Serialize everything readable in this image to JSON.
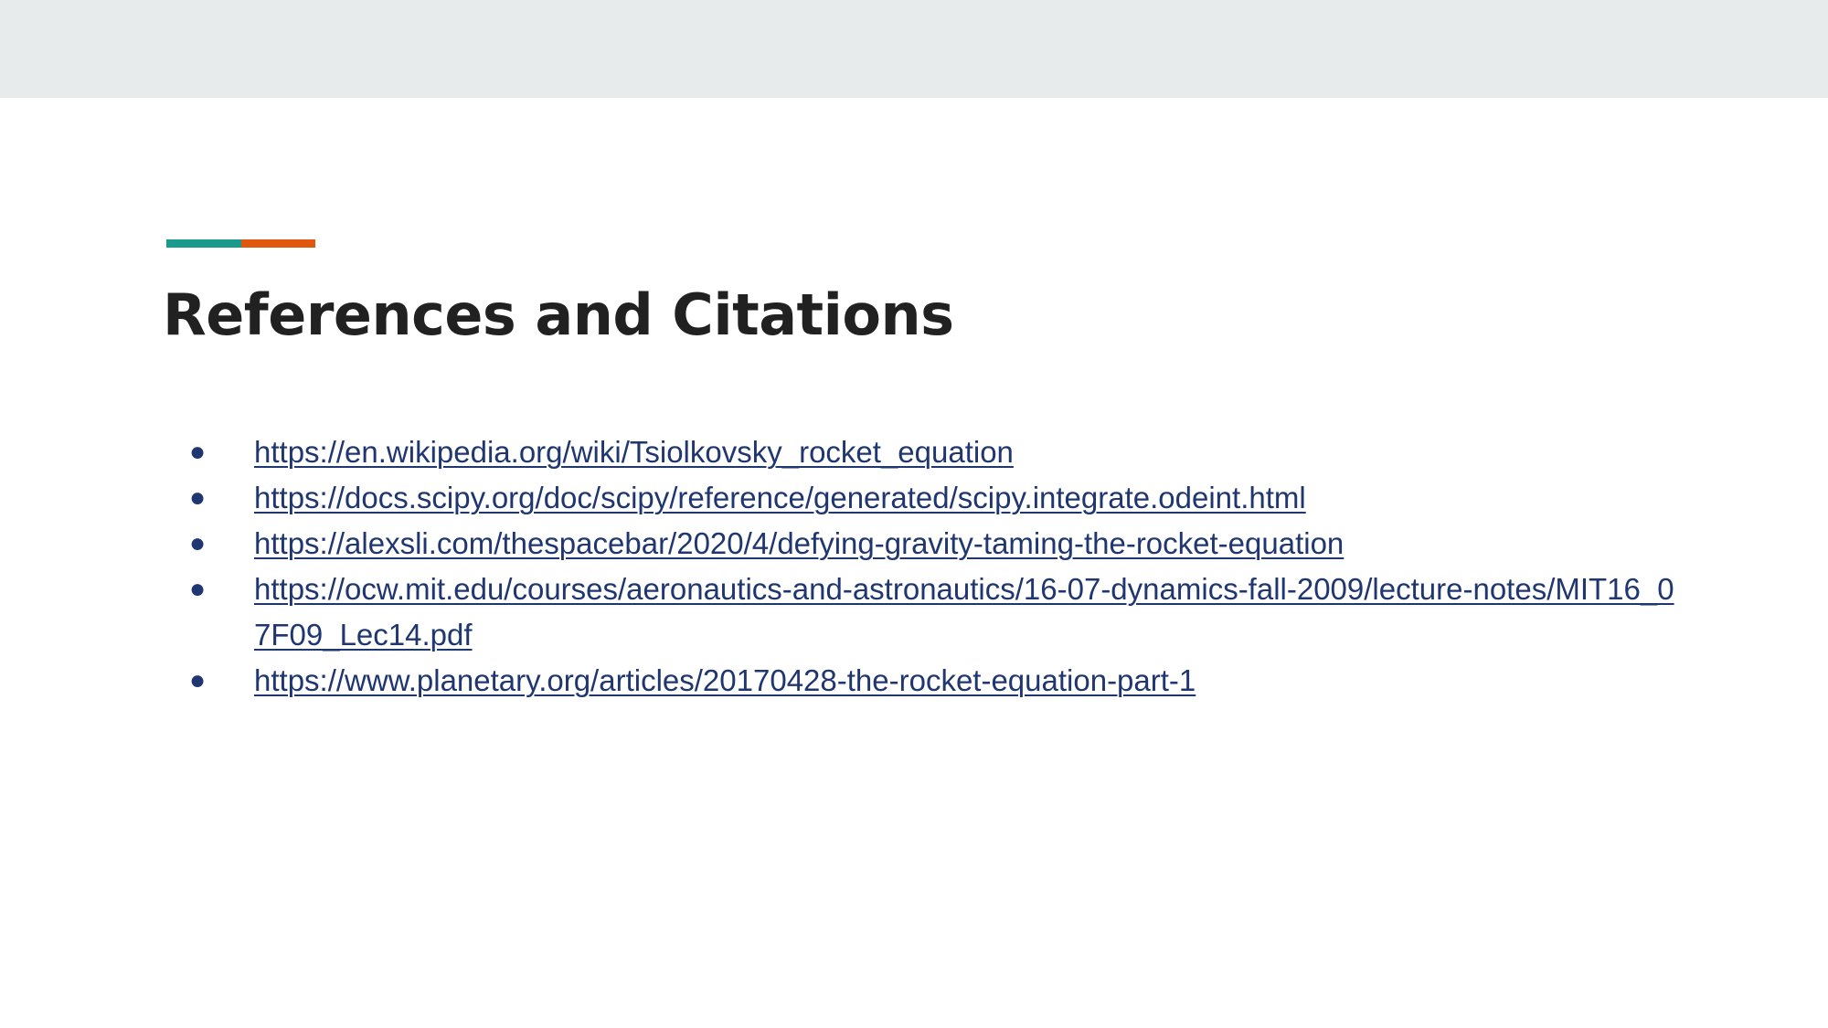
{
  "colors": {
    "top_band": "#e8ebec",
    "accent_teal": "#1a9a8c",
    "accent_orange": "#e0580e",
    "title": "#212121",
    "link": "#1f3670"
  },
  "slide": {
    "title": "References and Citations",
    "references": [
      "https://en.wikipedia.org/wiki/Tsiolkovsky_rocket_equation",
      "https://docs.scipy.org/doc/scipy/reference/generated/scipy.integrate.odeint.html",
      "https://alexsli.com/thespacebar/2020/4/defying-gravity-taming-the-rocket-equation",
      "https://ocw.mit.edu/courses/aeronautics-and-astronautics/16-07-dynamics-fall-2009/lecture-notes/MIT16_07F09_Lec14.pdf",
      "https://www.planetary.org/articles/20170428-the-rocket-equation-part-1"
    ],
    "bullet_glyph": "●"
  }
}
